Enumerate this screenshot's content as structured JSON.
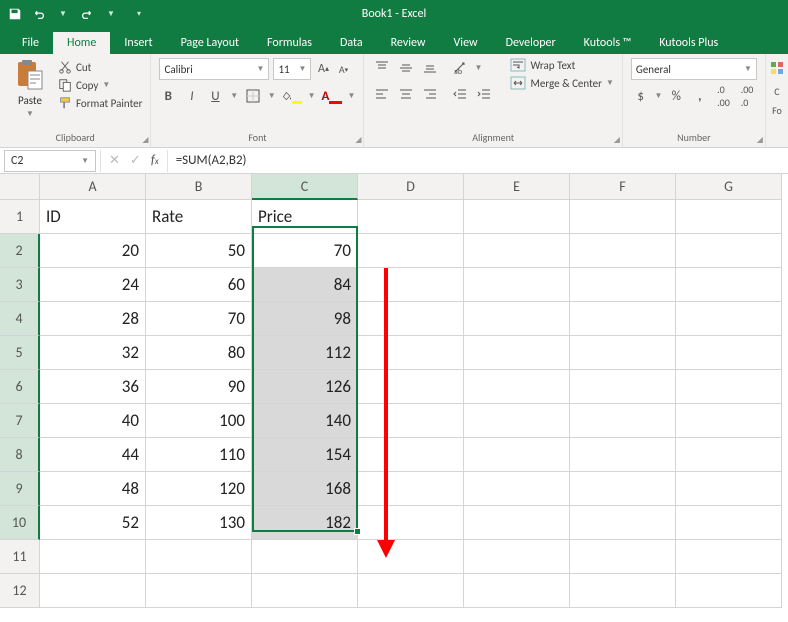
{
  "title": "Book1 - Excel",
  "tabs": [
    "File",
    "Home",
    "Insert",
    "Page Layout",
    "Formulas",
    "Data",
    "Review",
    "View",
    "Developer",
    "Kutools ™",
    "Kutools Plus"
  ],
  "active_tab": "Home",
  "clipboard": {
    "paste": "Paste",
    "cut": "Cut",
    "copy": "Copy",
    "format_painter": "Format Painter",
    "label": "Clipboard"
  },
  "font": {
    "name": "Calibri",
    "size": "11",
    "label": "Font"
  },
  "alignment": {
    "wrap": "Wrap Text",
    "merge": "Merge & Center",
    "label": "Alignment"
  },
  "number": {
    "format": "General",
    "label": "Number"
  },
  "cells_edge": {
    "c": "C",
    "fo": "Fo"
  },
  "namebox": "C2",
  "formula": "=SUM(A2,B2)",
  "columns": [
    "A",
    "B",
    "C",
    "D",
    "E",
    "F",
    "G"
  ],
  "headers": [
    "ID",
    "Rate",
    "Price"
  ],
  "rows": [
    {
      "n": 1,
      "a": "ID",
      "b": "Rate",
      "c": "Price"
    },
    {
      "n": 2,
      "a": "20",
      "b": "50",
      "c": "70"
    },
    {
      "n": 3,
      "a": "24",
      "b": "60",
      "c": "84"
    },
    {
      "n": 4,
      "a": "28",
      "b": "70",
      "c": "98"
    },
    {
      "n": 5,
      "a": "32",
      "b": "80",
      "c": "112"
    },
    {
      "n": 6,
      "a": "36",
      "b": "90",
      "c": "126"
    },
    {
      "n": 7,
      "a": "40",
      "b": "100",
      "c": "140"
    },
    {
      "n": 8,
      "a": "44",
      "b": "110",
      "c": "154"
    },
    {
      "n": 9,
      "a": "48",
      "b": "120",
      "c": "168"
    },
    {
      "n": 10,
      "a": "52",
      "b": "130",
      "c": "182"
    },
    {
      "n": 11,
      "a": "",
      "b": "",
      "c": ""
    },
    {
      "n": 12,
      "a": "",
      "b": "",
      "c": ""
    }
  ]
}
